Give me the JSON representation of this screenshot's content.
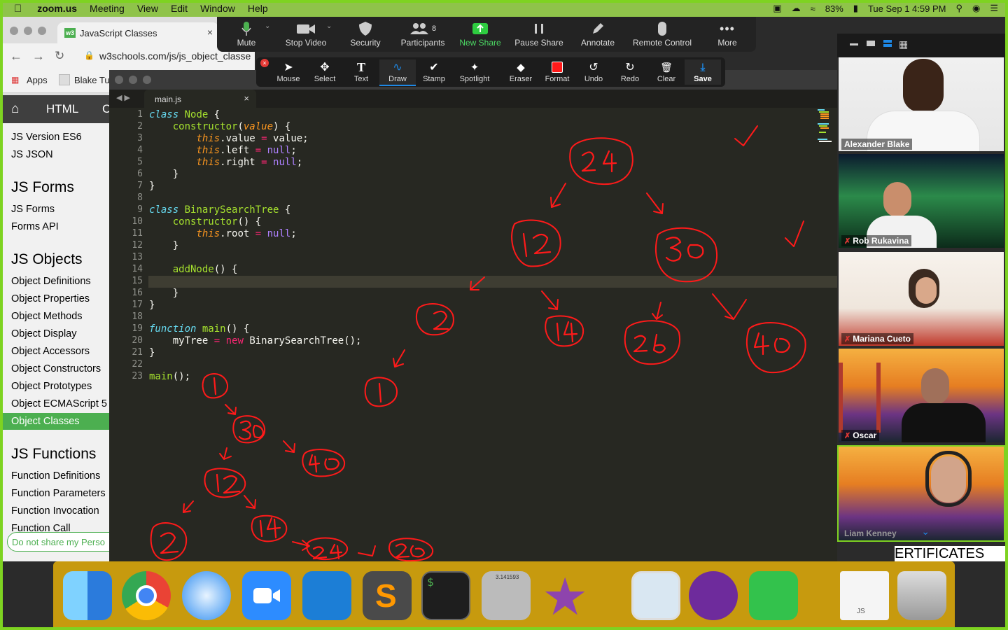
{
  "menubar": {
    "app": "zoom.us",
    "items": [
      "Meeting",
      "View",
      "Edit",
      "Window",
      "Help"
    ],
    "battery": "83%",
    "datetime": "Tue Sep 1  4:59 PM"
  },
  "browser": {
    "tab_title": "JavaScript Classes",
    "tab_icon": "w3",
    "url": "w3schools.com/js/js_object_classe",
    "bookmarks": [
      "Apps",
      "Blake Tu"
    ]
  },
  "w3nav": {
    "html": "HTML",
    "css": "C"
  },
  "sidebar": {
    "items": [
      {
        "type": "item",
        "label": "JS Version ES6"
      },
      {
        "type": "item",
        "label": "JS JSON"
      },
      {
        "type": "head",
        "label": "JS Forms"
      },
      {
        "type": "item",
        "label": "JS Forms"
      },
      {
        "type": "item",
        "label": "Forms API"
      },
      {
        "type": "head",
        "label": "JS Objects"
      },
      {
        "type": "item",
        "label": "Object Definitions"
      },
      {
        "type": "item",
        "label": "Object Properties"
      },
      {
        "type": "item",
        "label": "Object Methods"
      },
      {
        "type": "item",
        "label": "Object Display"
      },
      {
        "type": "item",
        "label": "Object Accessors"
      },
      {
        "type": "item",
        "label": "Object Constructors"
      },
      {
        "type": "item",
        "label": "Object Prototypes"
      },
      {
        "type": "item",
        "label": "Object ECMAScript 5"
      },
      {
        "type": "active",
        "label": "Object Classes"
      },
      {
        "type": "head",
        "label": "JS Functions"
      },
      {
        "type": "item",
        "label": "Function Definitions"
      },
      {
        "type": "item",
        "label": "Function Parameters"
      },
      {
        "type": "item",
        "label": "Function Invocation"
      },
      {
        "type": "item",
        "label": "Function Call"
      }
    ],
    "do_not_share": "Do not share my Perso"
  },
  "editor": {
    "tab": "main.js",
    "line_numbers": [
      "1",
      "2",
      "3",
      "4",
      "5",
      "6",
      "7",
      "8",
      "9",
      "10",
      "11",
      "12",
      "13",
      "14",
      "15",
      "16",
      "17",
      "18",
      "19",
      "20",
      "21",
      "22",
      "23"
    ],
    "current_line": "15"
  },
  "zoom_toolbar": {
    "buttons": [
      "Mute",
      "Stop Video",
      "Security",
      "Participants",
      "New Share",
      "Pause Share",
      "Annotate",
      "Remote Control",
      "More"
    ],
    "participants_count": "8"
  },
  "annotation_toolbar": {
    "buttons": [
      "Mouse",
      "Select",
      "Text",
      "Draw",
      "Stamp",
      "Spotlight",
      "Eraser",
      "Format",
      "Undo",
      "Redo",
      "Clear",
      "Save"
    ]
  },
  "gallery": {
    "participants": [
      "Alexander Blake",
      "Rob Rukavina",
      "Mariana Cueto",
      "Oscar",
      "Liam Kenney"
    ]
  },
  "page_fragment": "ERTIFICATES",
  "annotations": {
    "nodes": [
      "24",
      "12",
      "30",
      "2",
      "14",
      "26",
      "40",
      "1",
      "1",
      "30",
      "40",
      "12",
      "2",
      "14",
      "24",
      "26"
    ],
    "color": "#ff1a1a"
  },
  "dock": {
    "apps": [
      "finder-icon",
      "chrome-icon",
      "safari-icon",
      "zoom-icon",
      "xcode-icon",
      "sublime-icon",
      "terminal-icon",
      "calculator-icon",
      "imovie-icon",
      "preview-icon",
      "github-icon",
      "facetime-icon",
      "js-file-icon",
      "trash-icon"
    ],
    "calc_display": "3.141593"
  },
  "colors": {
    "share_border": "#7ed321",
    "w3_green": "#4caf50",
    "editor_bg": "#272822"
  }
}
